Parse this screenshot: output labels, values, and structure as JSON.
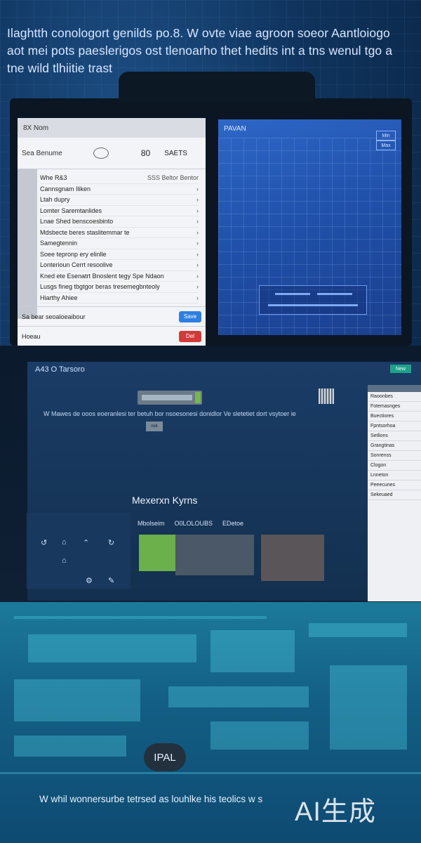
{
  "header": {
    "paragraph": "Ilaghtth conologort genilds po.8. W ovte viae agroon soeor Aantloiogo aot mei pots paeslerigos ost tlenoarho thet hedits int a tns wenul tgo a tne wild tlhiitie trast"
  },
  "white_window": {
    "title": "8X Nom",
    "toolbar_left": "Sea Benume",
    "toolbar_num": "80",
    "toolbar_right": "SAETS",
    "rows": [
      {
        "label": "Whe R&3",
        "value": "SSS Beltor Bentor"
      },
      {
        "label": "Cannsgnam Iliken",
        "value": ""
      },
      {
        "label": "Ltah dupry",
        "value": ""
      },
      {
        "label": "Lomter Saremtanlides",
        "value": ""
      },
      {
        "label": "Lnae Shed benscoesbinto",
        "value": ""
      },
      {
        "label": "Mdsbecte beres staslitemmar te",
        "value": ""
      },
      {
        "label": "Samegtennin",
        "value": ""
      },
      {
        "label": "Soee tepronp ery elinlle",
        "value": ""
      },
      {
        "label": "Lonterioun Cerrt resoolive",
        "value": ""
      },
      {
        "label": "Kned ete Esenatrt Bnoslent tegy Spe Ndaon",
        "value": ""
      },
      {
        "label": "Lusgs fineg tbgtgor beras tresemegbnteoly",
        "value": ""
      },
      {
        "label": "Hiarthy Ahiee",
        "value": ""
      }
    ],
    "footer1_label": "Sa bear seoaloeaibour",
    "footer1_button": "Save",
    "footer2_label": "Hoeau",
    "footer2_button": "Del"
  },
  "blue_window": {
    "title": "PAVAN",
    "btn1": "Min",
    "btn2": "Max"
  },
  "mid": {
    "title": "A43 O Tarsoro",
    "badge": "New",
    "description": "W Mawes de ooos eoeranlesi ter betuh bor nsoesonesi donidlor Ve sletetiet dort vsytoer ie",
    "chip_label": "nsk",
    "heading": "Mexerxn Kyrns",
    "tab1": "Mbolseim",
    "tab2": "O0LOLOUBS",
    "tab3": "EDetoe"
  },
  "side_window": {
    "items": [
      "Raoonbes",
      "Fotemasnges",
      "Buectiores",
      "Fpntsorhoa",
      "Setlions",
      "Grangtinas",
      "Sonrenss",
      "Clogon",
      "Lnneton",
      "Peeecunes",
      "Sekeuaed"
    ]
  },
  "bottom": {
    "chip_text": "IPAL",
    "caption": "W whil wonnersurbe tetrsed as louhlke his teolics w s",
    "watermark": "AI生成"
  }
}
